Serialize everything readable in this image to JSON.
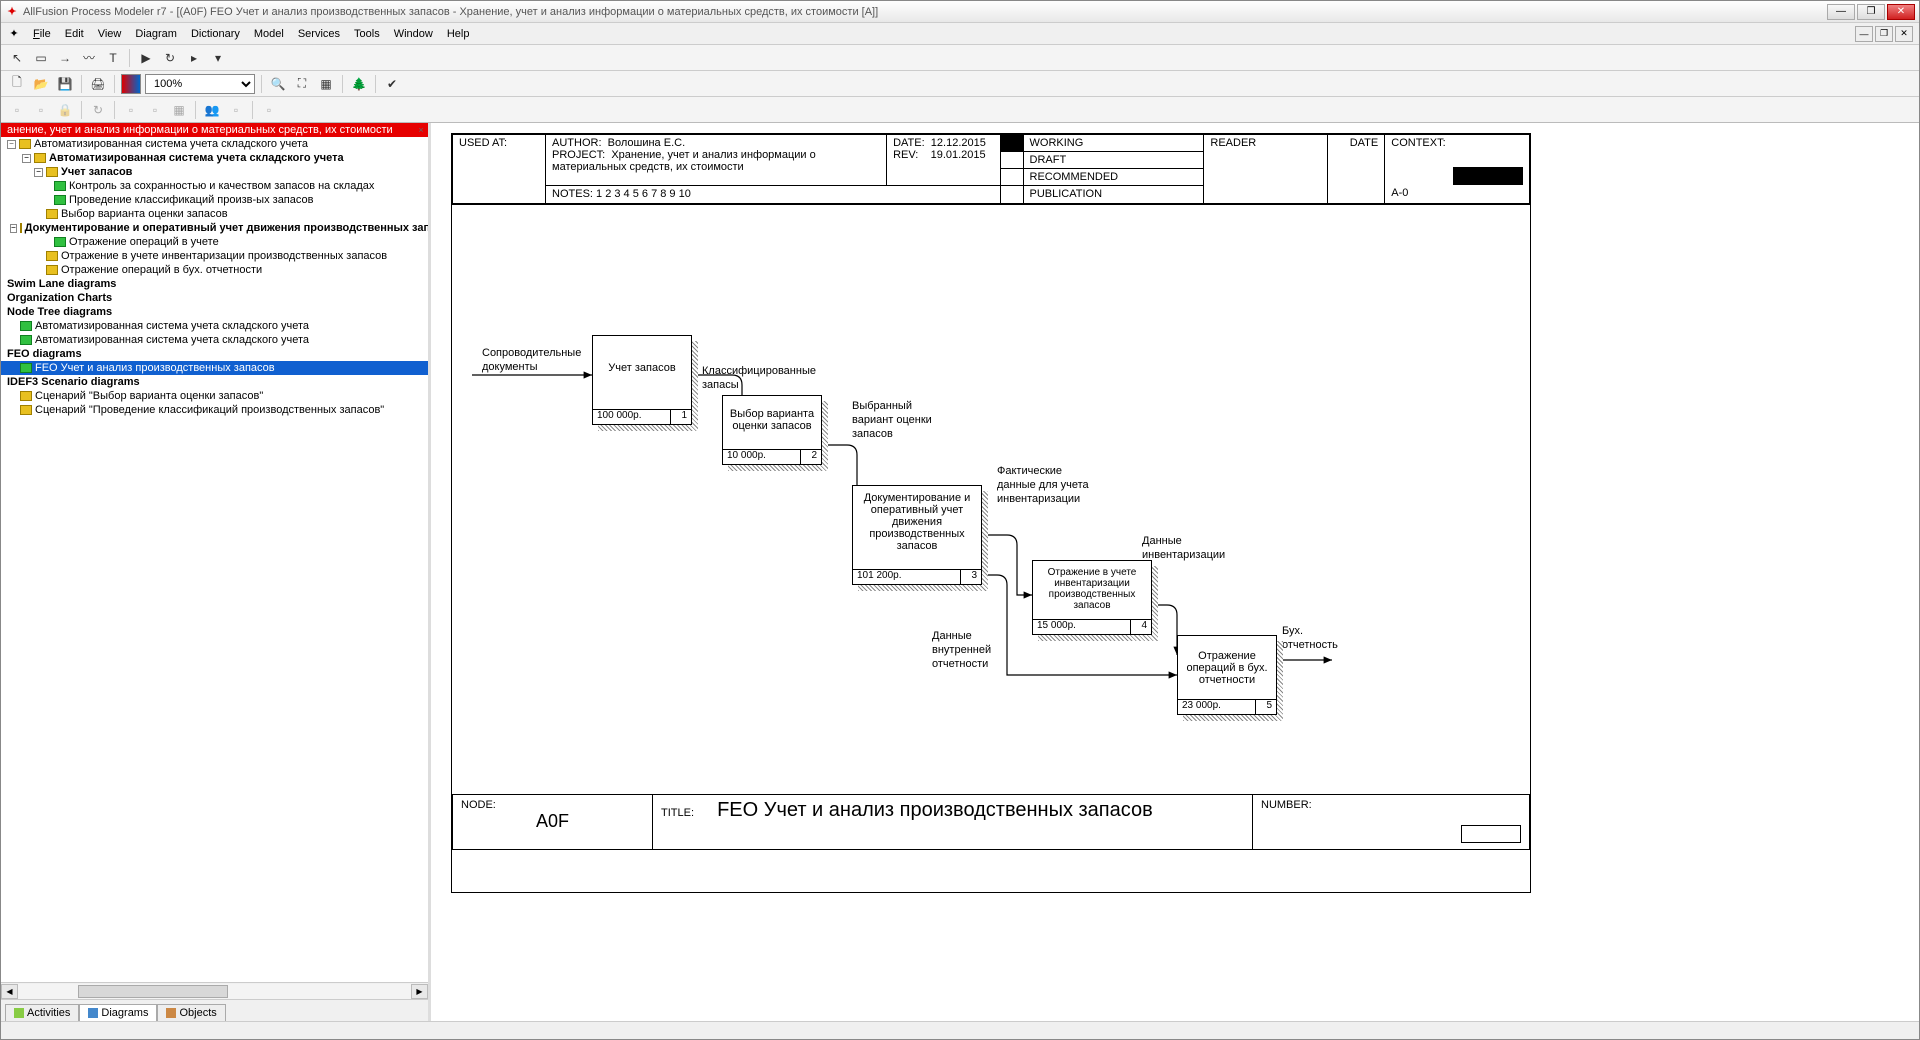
{
  "titlebar": {
    "text": "AllFusion Process Modeler r7 - [(A0F) FEO Учет и анализ производственных запасов - Хранение, учет и анализ информации о материальных средств, их стоимости  [A]]"
  },
  "menu": {
    "file": "File",
    "edit": "Edit",
    "view": "View",
    "diagram": "Diagram",
    "dictionary": "Dictionary",
    "model": "Model",
    "services": "Services",
    "tools": "Tools",
    "window": "Window",
    "help": "Help"
  },
  "zoom": "100%",
  "tree": {
    "root_truncated": "анение, учет и анализ информации о материальных средств, их стоимости",
    "n1": "Автоматизированная система учета складского учета",
    "n2": "Автоматизированная система учета складского учета",
    "n3": "Учет запасов",
    "n4": "Контроль за  сохранностью и качеством запасов на складах",
    "n5": "Проведение  классификаций произв-ых  запасов",
    "n6": "Выбор варианта  оценки запасов",
    "n7": "Документирование  и оперативный учет  движения производственных  запасов",
    "n8": "Отражение операций в учете",
    "n9": "Отражение в учете  инвентаризации  производственных  запасов",
    "n10": "Отражение  операций в  бух. отчетности",
    "swim": "Swim Lane diagrams",
    "org": "Organization Charts",
    "ntree": "Node Tree diagrams",
    "nt1": "Автоматизированная система учета складского учета",
    "nt2": "Автоматизированная система учета складского учета",
    "feo": "FEO diagrams",
    "feo1": "FEO Учет и анализ производственных запасов",
    "idef3": "IDEF3 Scenario diagrams",
    "sc1": "Сценарий \"Выбор варианта оценки запасов\"",
    "sc2": "Сценарий \"Проведение классификаций производственных запасов\""
  },
  "tabs": {
    "activities": "Activities",
    "diagrams": "Diagrams",
    "objects": "Objects"
  },
  "header": {
    "used_at": "USED AT:",
    "author_l": "AUTHOR:",
    "author_v": "Волошина Е.С.",
    "project_l": "PROJECT:",
    "project_v": "Хранение, учет и анализ информации о материальных средств, их стоимости",
    "date_l": "DATE:",
    "date_v": "12.12.2015",
    "rev_l": "REV:",
    "rev_v": "19.01.2015",
    "working": "WORKING",
    "draft": "DRAFT",
    "recommended": "RECOMMENDED",
    "publication": "PUBLICATION",
    "reader": "READER",
    "date2": "DATE",
    "context": "CONTEXT:",
    "context_v": "A-0",
    "notes": "NOTES:  1  2  3  4  5  6  7  8  9  10"
  },
  "footer": {
    "node_l": "NODE:",
    "node_v": "A0F",
    "title_l": "TITLE:",
    "title_v": "FEO Учет и анализ производственных запасов",
    "number_l": "NUMBER:"
  },
  "boxes": {
    "b1": {
      "title": "Учет запасов",
      "cost": "100 000р.",
      "num": "1"
    },
    "b2": {
      "title": "Выбор варианта оценки запасов",
      "cost": "10 000р.",
      "num": "2"
    },
    "b3": {
      "title": "Документирование и оперативный учет движения производственных запасов",
      "cost": "101 200р.",
      "num": "3"
    },
    "b4": {
      "title": "Отражение в учете инвентаризации производственных запасов",
      "cost": "15 000р.",
      "num": "4"
    },
    "b5": {
      "title": "Отражение операций в бух. отчетности",
      "cost": "23 000р.",
      "num": "5"
    }
  },
  "labels": {
    "l1": "Сопроводительные документы",
    "l2": "Классифицированные запасы",
    "l3": "Выбранный вариант оценки запасов",
    "l4": "Фактические данные для учета инвентаризации",
    "l5": "Данные инвентаризации",
    "l6": "Данные внутренней отчетности",
    "l7": "Бух. отчетность"
  }
}
